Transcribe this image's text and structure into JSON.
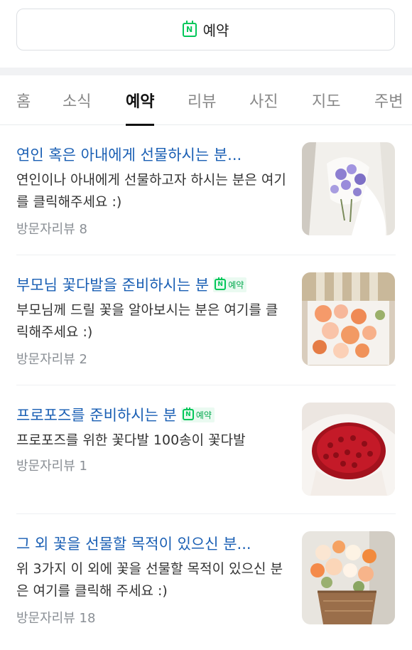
{
  "reserve_button": {
    "label": "예약",
    "icon": "naver-reservation-icon"
  },
  "tabs": [
    {
      "label": "홈",
      "active": false
    },
    {
      "label": "소식",
      "active": false
    },
    {
      "label": "예약",
      "active": true
    },
    {
      "label": "리뷰",
      "active": false
    },
    {
      "label": "사진",
      "active": false
    },
    {
      "label": "지도",
      "active": false
    },
    {
      "label": "주변",
      "active": false
    }
  ],
  "items": [
    {
      "title": "연인 혹은 아내에게 선물하시는 분...",
      "desc": "연인이나 아내에게 선물하고자 하시는 분은 여기를 클릭해주세요 :)",
      "meta": "방문자리뷰 8",
      "badge": null
    },
    {
      "title": "부모님 꽃다발을 준비하시는 분",
      "desc": "부모님께 드릴 꽃을 알아보시는 분은 여기를 클릭해주세요 :)",
      "meta": "방문자리뷰 2",
      "badge": "예약"
    },
    {
      "title": "프로포즈를 준비하시는 분",
      "desc": "프로포즈를 위한 꽃다발 100송이 꽃다발",
      "meta": "방문자리뷰 1",
      "badge": "예약"
    },
    {
      "title": "그 외 꽃을 선물할 목적이 있으신 분...",
      "desc": "위 3가지 이 외에 꽃을 선물할 목적이 있으신 분은 여기를 클릭해 주세요 :)",
      "meta": "방문자리뷰 18",
      "badge": null
    }
  ],
  "colors": {
    "link": "#1a5fb4",
    "naver_green": "#03c75a",
    "meta_gray": "#8a8f95"
  }
}
